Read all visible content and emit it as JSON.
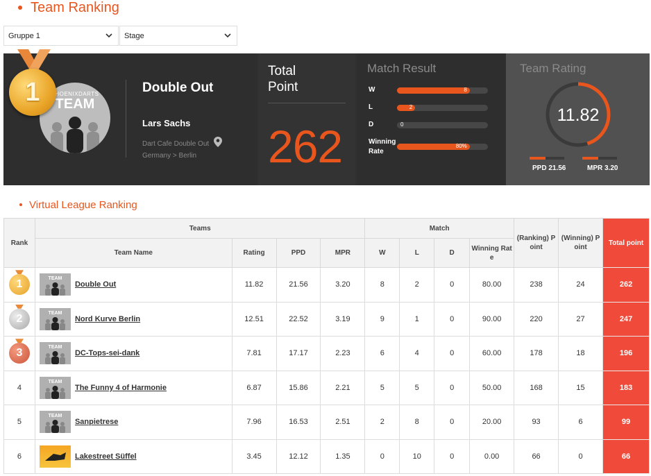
{
  "header": {
    "title": "Team Ranking"
  },
  "filters": {
    "group": "Gruppe 1",
    "stage": "Stage"
  },
  "summary": {
    "team_name": "Double Out",
    "logo_brand": "PHOENIXDARTS",
    "logo_word": "TEAM",
    "rank_medal": "1",
    "captain": "Lars Sachs",
    "venue": "Dart Cafe Double Out",
    "location": "Germany > Berlin",
    "total_label_1": "Total",
    "total_label_2": "Point",
    "total_point": "262",
    "match_result": {
      "title": "Match Result",
      "w_label": "W",
      "w_value": "8",
      "w_fill": 0.8,
      "l_label": "L",
      "l_value": "2",
      "l_fill": 0.2,
      "d_label": "D",
      "d_value": "0",
      "d_fill": 0.0,
      "rate_label_1": "Winning",
      "rate_label_2": "Rate",
      "rate_value": "80%",
      "rate_fill": 0.8
    },
    "team_rating": {
      "title": "Team Rating",
      "value": "11.82",
      "gauge_fill": 0.45,
      "ppd_label": "PPD 21.56",
      "ppd_fill": 0.45,
      "mpr_label": "MPR 3.20",
      "mpr_fill": 0.45
    }
  },
  "section": {
    "title": "Virtual League Ranking"
  },
  "table": {
    "h_rank": "Rank",
    "h_teams": "Teams",
    "h_match": "Match",
    "h_ranking_point": "(Ranking) P oint",
    "h_winning_point": "(Winning) P oint",
    "h_total": "Total point",
    "h_team_name": "Team Name",
    "h_rating": "Rating",
    "h_ppd": "PPD",
    "h_mpr": "MPR",
    "h_w": "W",
    "h_l": "L",
    "h_d": "D",
    "h_winning_rate": "Winning Rat e",
    "thumb_text": "TEAM",
    "rows": [
      {
        "rank": "1",
        "team": "Double Out",
        "rating": "11.82",
        "ppd": "21.56",
        "mpr": "3.20",
        "w": "8",
        "l": "2",
        "d": "0",
        "rate": "80.00",
        "rpoint": "238",
        "wpoint": "24",
        "total": "262"
      },
      {
        "rank": "2",
        "team": "Nord Kurve Berlin",
        "rating": "12.51",
        "ppd": "22.52",
        "mpr": "3.19",
        "w": "9",
        "l": "1",
        "d": "0",
        "rate": "90.00",
        "rpoint": "220",
        "wpoint": "27",
        "total": "247"
      },
      {
        "rank": "3",
        "team": "DC-Tops-sei-dank",
        "rating": "7.81",
        "ppd": "17.17",
        "mpr": "2.23",
        "w": "6",
        "l": "4",
        "d": "0",
        "rate": "60.00",
        "rpoint": "178",
        "wpoint": "18",
        "total": "196"
      },
      {
        "rank": "4",
        "team": "The Funny 4 of Harmonie",
        "rating": "6.87",
        "ppd": "15.86",
        "mpr": "2.21",
        "w": "5",
        "l": "5",
        "d": "0",
        "rate": "50.00",
        "rpoint": "168",
        "wpoint": "15",
        "total": "183"
      },
      {
        "rank": "5",
        "team": "Sanpietrese",
        "rating": "7.96",
        "ppd": "16.53",
        "mpr": "2.51",
        "w": "2",
        "l": "8",
        "d": "0",
        "rate": "20.00",
        "rpoint": "93",
        "wpoint": "6",
        "total": "99"
      },
      {
        "rank": "6",
        "team": "Lakestreet Süffel",
        "rating": "3.45",
        "ppd": "12.12",
        "mpr": "1.35",
        "w": "0",
        "l": "10",
        "d": "0",
        "rate": "0.00",
        "rpoint": "66",
        "wpoint": "0",
        "total": "66"
      }
    ]
  }
}
